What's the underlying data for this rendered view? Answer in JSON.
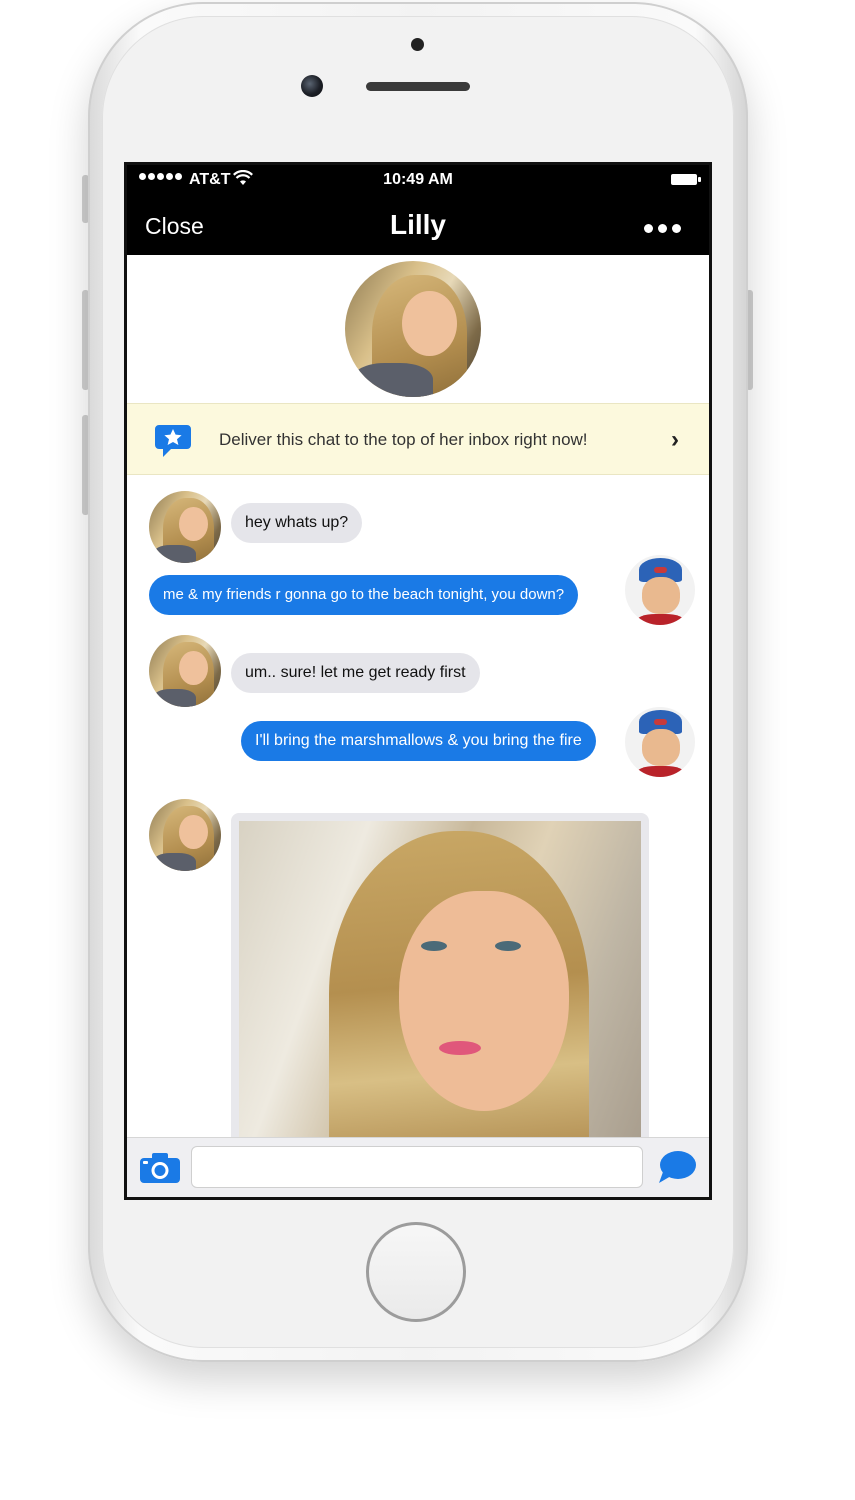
{
  "status_bar": {
    "carrier": "AT&T",
    "time": "10:49 AM"
  },
  "nav": {
    "close_label": "Close",
    "title": "Lilly"
  },
  "promo": {
    "text": "Deliver this chat to the top of her inbox right now!",
    "chevron": "›"
  },
  "messages": [
    {
      "direction": "in",
      "text": "hey whats up?"
    },
    {
      "direction": "out",
      "text": "me & my friends r gonna go to the beach tonight, you down?"
    },
    {
      "direction": "in",
      "text": "um.. sure! let me get ready first"
    },
    {
      "direction": "out",
      "text": "I'll bring the marshmallows & you bring the fire"
    },
    {
      "direction": "in",
      "type": "photo"
    }
  ],
  "composer": {
    "placeholder": "",
    "value": ""
  },
  "colors": {
    "outgoing_bubble": "#1a7ae6",
    "incoming_bubble": "#e5e5ea",
    "promo_background": "#fcf9dd",
    "nav_background": "#000000",
    "accent": "#1a7ae6"
  },
  "icons": {
    "promo": "star-chat-bubble-icon",
    "camera": "camera-icon",
    "send": "chat-bubble-send-icon",
    "more": "ellipsis-icon",
    "wifi": "wifi-icon",
    "battery": "battery-icon"
  }
}
